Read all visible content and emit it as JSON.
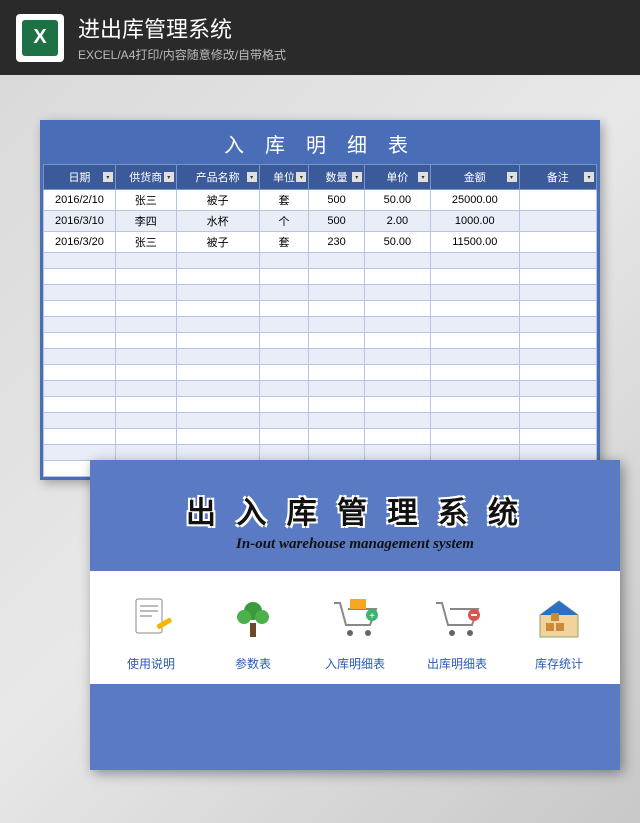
{
  "header": {
    "title": "进出库管理系统",
    "subtitle": "EXCEL/A4打印/内容随意修改/自带格式",
    "icon_letter": "X"
  },
  "sheet": {
    "title": "入 库 明 细 表",
    "columns": [
      "日期",
      "供货商",
      "产品名称",
      "单位",
      "数量",
      "单价",
      "金额",
      "备注"
    ],
    "rows": [
      {
        "date": "2016/2/10",
        "supplier": "张三",
        "product": "被子",
        "unit": "套",
        "qty": "500",
        "price": "50.00",
        "amount": "25000.00",
        "note": ""
      },
      {
        "date": "2016/3/10",
        "supplier": "李四",
        "product": "水杯",
        "unit": "个",
        "qty": "500",
        "price": "2.00",
        "amount": "1000.00",
        "note": ""
      },
      {
        "date": "2016/3/20",
        "supplier": "张三",
        "product": "被子",
        "unit": "套",
        "qty": "230",
        "price": "50.00",
        "amount": "11500.00",
        "note": ""
      }
    ],
    "empty_rows": 14
  },
  "nav": {
    "title": "出 入 库 管 理 系 统",
    "subtitle": "In-out warehouse management system",
    "items": [
      {
        "label": "使用说明",
        "icon": "doc"
      },
      {
        "label": "参数表",
        "icon": "tree"
      },
      {
        "label": "入库明细表",
        "icon": "cart-in"
      },
      {
        "label": "出库明细表",
        "icon": "cart-out"
      },
      {
        "label": "库存统计",
        "icon": "warehouse"
      }
    ]
  }
}
